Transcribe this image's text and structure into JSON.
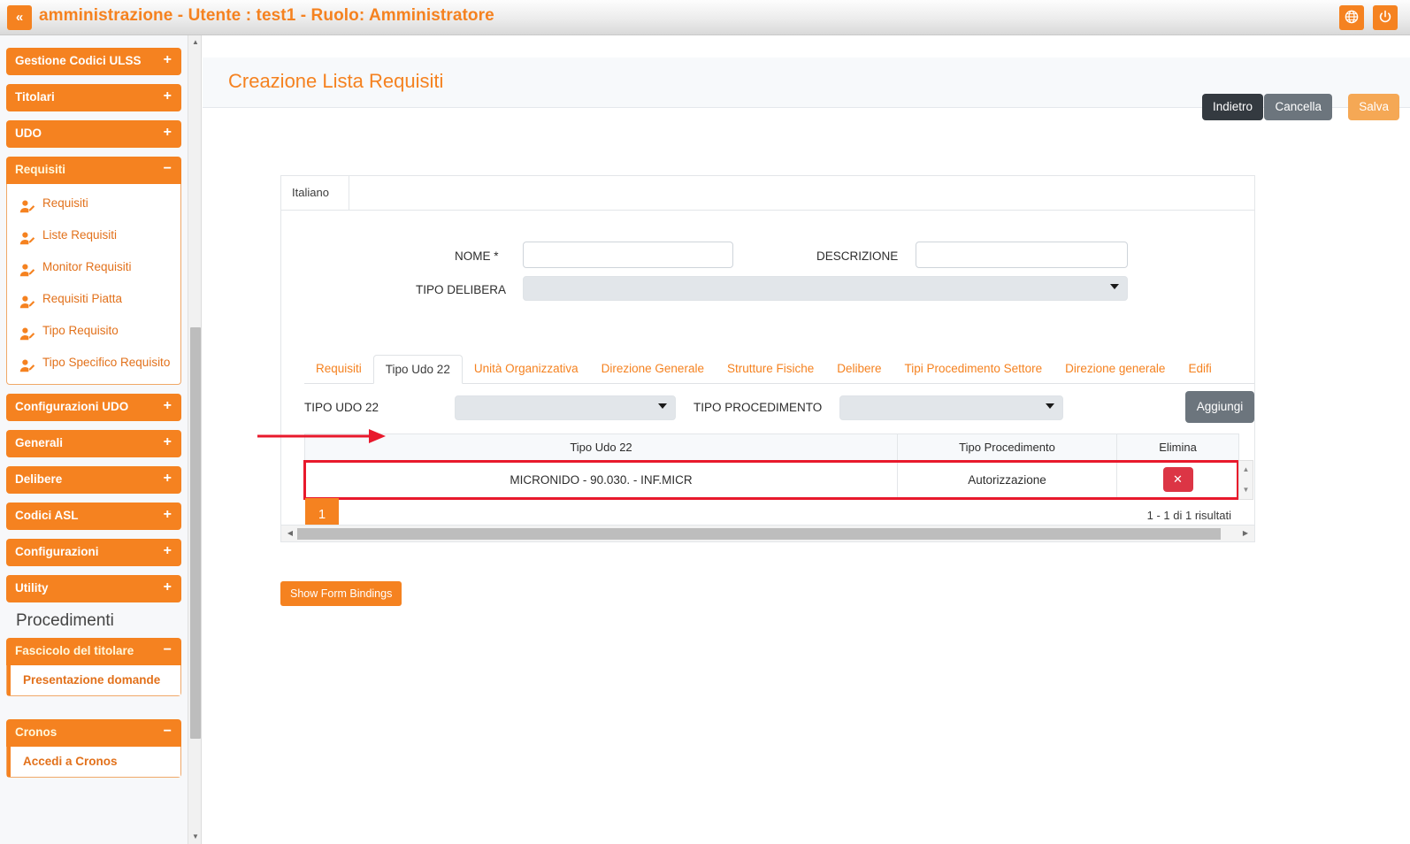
{
  "titlebar": {
    "collapse_label": "«",
    "title": "amministrazione - Utente : test1 - Ruolo: Amministratore",
    "lang_icon": "globe-icon",
    "power_icon": "power-icon",
    "accent_color": "#f58220"
  },
  "sidebar": {
    "groups": [
      {
        "label": "Gestione Codici ULSS",
        "sign": "+",
        "open": false
      },
      {
        "label": "Titolari",
        "sign": "+",
        "open": false
      },
      {
        "label": "UDO",
        "sign": "+",
        "open": false
      },
      {
        "label": "Requisiti",
        "sign": "−",
        "open": true
      }
    ],
    "requisiti_items": [
      {
        "label": "Requisiti",
        "icon": "user-edit-icon"
      },
      {
        "label": "Liste Requisiti",
        "icon": "user-edit-icon"
      },
      {
        "label": "Monitor Requisiti",
        "icon": "user-edit-icon"
      },
      {
        "label": "Requisiti Piatta",
        "icon": "user-edit-icon"
      },
      {
        "label": "Tipo Requisito",
        "icon": "user-edit-icon"
      },
      {
        "label": "Tipo Specifico Requisito",
        "icon": "user-edit-icon"
      }
    ],
    "groups2": [
      {
        "label": "Configurazioni UDO",
        "sign": "+"
      },
      {
        "label": "Generali",
        "sign": "+"
      },
      {
        "label": "Delibere",
        "sign": "+"
      },
      {
        "label": "Codici ASL",
        "sign": "+"
      },
      {
        "label": "Configurazioni",
        "sign": "+"
      },
      {
        "label": "Utility",
        "sign": "+"
      }
    ],
    "procedimenti_heading": "Procedimenti",
    "fascicolo": {
      "label": "Fascicolo del titolare",
      "sign": "−"
    },
    "fascicolo_item": "Presentazione domande",
    "cronos": {
      "label": "Cronos",
      "sign": "−"
    },
    "cronos_item": "Accedi a Cronos",
    "scroll_up_icon": "chevron-up-icon",
    "scroll_down_icon": "chevron-down-icon"
  },
  "page": {
    "title": "Creazione Lista Requisiti",
    "buttons": {
      "indietro": "Indietro",
      "cancella": "Cancella",
      "salva": "Salva"
    }
  },
  "form": {
    "language_tab": "Italiano",
    "nome_label": "NOME *",
    "nome_value": "",
    "descrizione_label": "DESCRIZIONE",
    "descrizione_value": "",
    "tipo_delibera_label": "TIPO DELIBERA",
    "tipo_delibera_value": ""
  },
  "tabs": [
    {
      "label": "Requisiti",
      "active": false
    },
    {
      "label": "Tipo Udo 22",
      "active": true
    },
    {
      "label": "Unità Organizzativa",
      "active": false
    },
    {
      "label": "Direzione Generale",
      "active": false
    },
    {
      "label": "Strutture Fisiche",
      "active": false
    },
    {
      "label": "Delibere",
      "active": false
    },
    {
      "label": "Tipi Procedimento Settore",
      "active": false
    },
    {
      "label": "Direzione generale",
      "active": false
    },
    {
      "label": "Edifi",
      "active": false
    }
  ],
  "filters": {
    "tipo_udo_label": "TIPO UDO 22",
    "tipo_udo_value": "",
    "tipo_procedimento_label": "TIPO PROCEDIMENTO",
    "tipo_procedimento_value": "",
    "aggiungi_label": "Aggiungi"
  },
  "table": {
    "columns": [
      "Tipo Udo 22",
      "Tipo Procedimento",
      "Elimina"
    ],
    "rows": [
      {
        "tipo_udo": "MICRONIDO - 90.030. - INF.MICR",
        "tipo_procedimento": "Autorizzazione",
        "delete_label": "✕"
      }
    ],
    "highlight_color": "#e8192c",
    "delete_color": "#dc3545"
  },
  "pagination": {
    "current_page": "1",
    "results_info": "1 - 1 di 1 risultati"
  },
  "footer": {
    "show_bindings_label": "Show Form Bindings"
  },
  "scroll": {
    "left_arrow": "◀",
    "right_arrow": "▶",
    "up_arrow": "▲",
    "down_arrow": "▼"
  }
}
